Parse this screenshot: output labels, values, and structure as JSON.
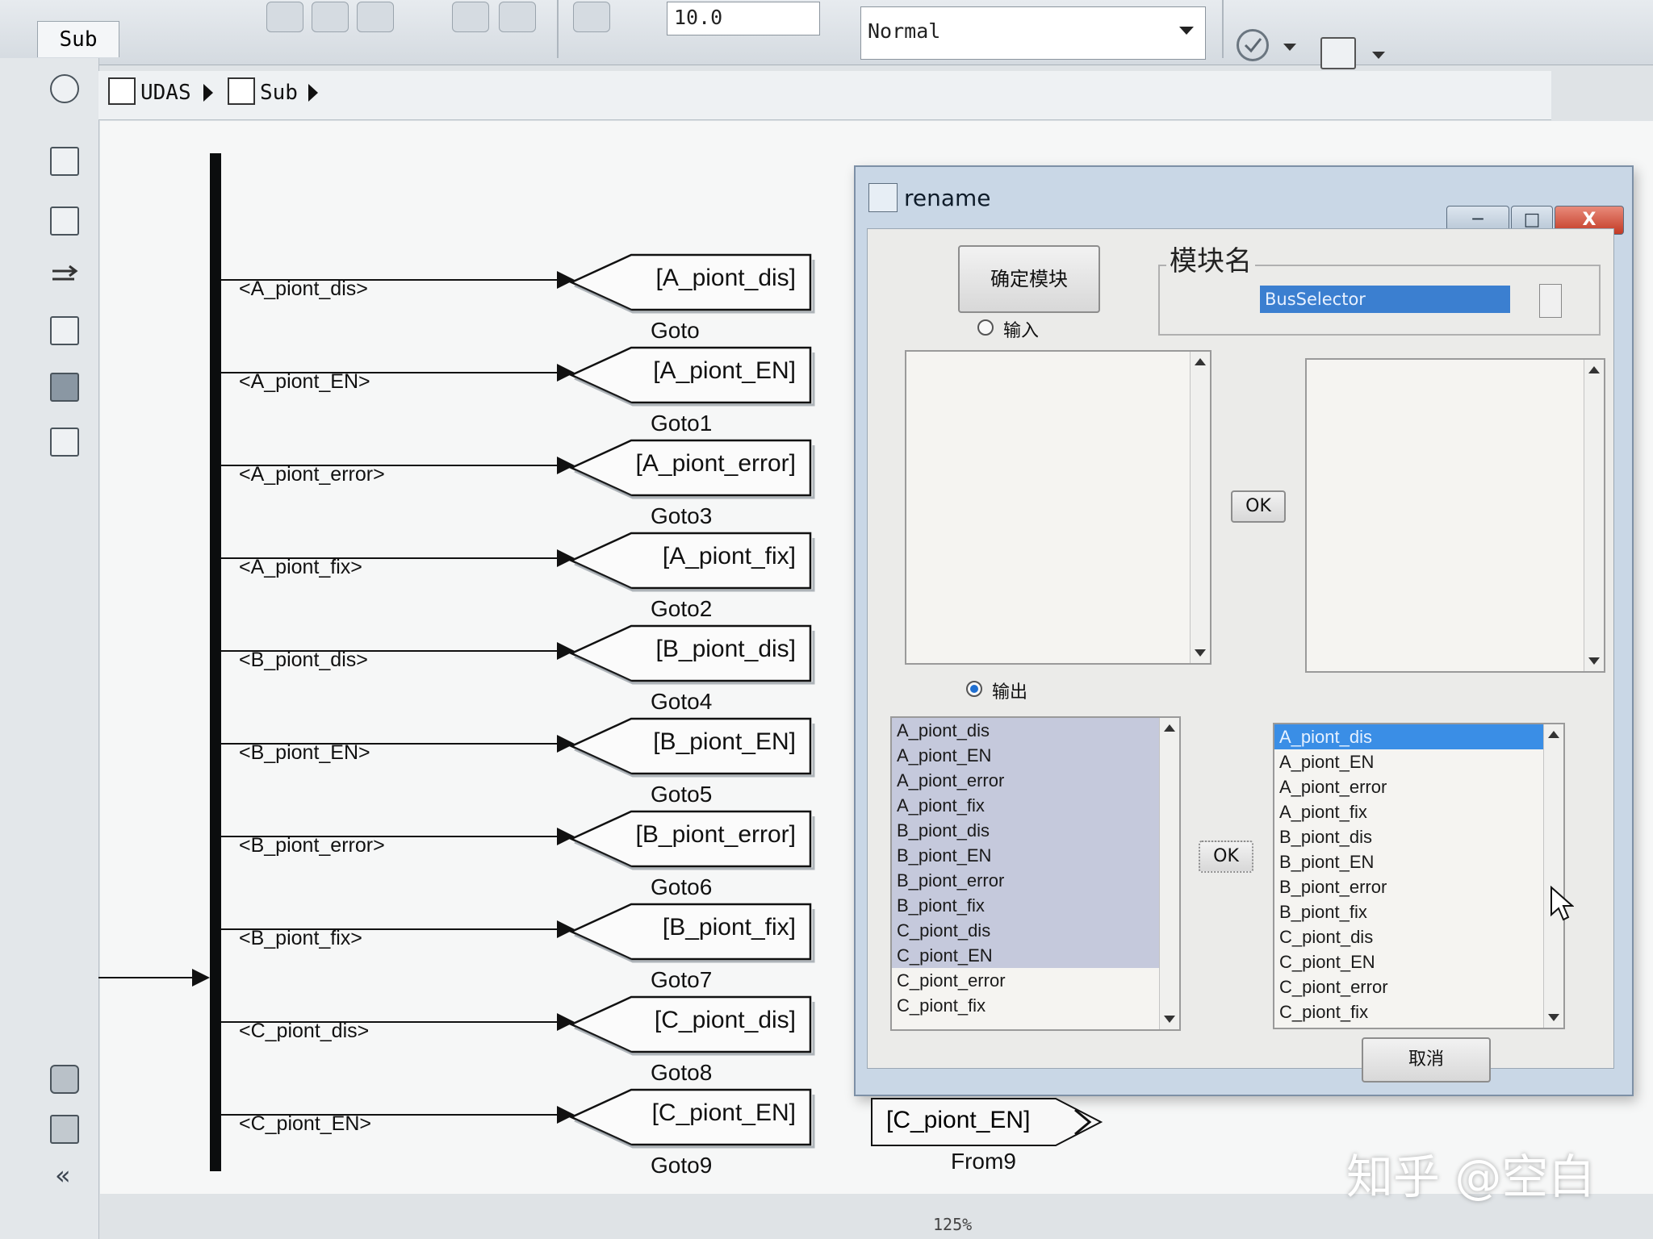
{
  "toolbar": {
    "sim_time": "10.0",
    "sim_mode": "Normal"
  },
  "tab": {
    "label": "Sub"
  },
  "breadcrumb": {
    "items": [
      "UDAS",
      "Sub"
    ]
  },
  "signals": [
    {
      "label": "<A_piont_dis>",
      "goto_tag": "[A_piont_dis]",
      "goto_name": "Goto"
    },
    {
      "label": "<A_piont_EN>",
      "goto_tag": "[A_piont_EN]",
      "goto_name": "Goto1"
    },
    {
      "label": "<A_piont_error>",
      "goto_tag": "[A_piont_error]",
      "goto_name": "Goto3"
    },
    {
      "label": "<A_piont_fix>",
      "goto_tag": "[A_piont_fix]",
      "goto_name": "Goto2"
    },
    {
      "label": "<B_piont_dis>",
      "goto_tag": "[B_piont_dis]",
      "goto_name": "Goto4"
    },
    {
      "label": "<B_piont_EN>",
      "goto_tag": "[B_piont_EN]",
      "goto_name": "Goto5"
    },
    {
      "label": "<B_piont_error>",
      "goto_tag": "[B_piont_error]",
      "goto_name": "Goto6"
    },
    {
      "label": "<B_piont_fix>",
      "goto_tag": "[B_piont_fix]",
      "goto_name": "Goto7"
    },
    {
      "label": "<C_piont_dis>",
      "goto_tag": "[C_piont_dis]",
      "goto_name": "Goto8"
    },
    {
      "label": "<C_piont_EN>",
      "goto_tag": "[C_piont_EN]",
      "goto_name": "Goto9"
    }
  ],
  "from_block": {
    "tag": "[C_piont_EN]",
    "name": "From9"
  },
  "dialog": {
    "title": "rename",
    "confirm_button": "确定模块",
    "block_name_group": "模块名",
    "block_name_value": "BusSelector",
    "input_radio": "输入",
    "output_radio": "输出",
    "ok_top": "OK",
    "ok_bottom": "OK",
    "cancel_button": "取消",
    "output_left_list": [
      "A_piont_dis",
      "A_piont_EN",
      "A_piont_error",
      "A_piont_fix",
      "B_piont_dis",
      "B_piont_EN",
      "B_piont_error",
      "B_piont_fix",
      "C_piont_dis",
      "C_piont_EN",
      "C_piont_error",
      "C_piont_fix"
    ],
    "output_right_list": [
      "A_piont_dis",
      "A_piont_EN",
      "A_piont_error",
      "A_piont_fix",
      "B_piont_dis",
      "B_piont_EN",
      "B_piont_error",
      "B_piont_fix",
      "C_piont_dis",
      "C_piont_EN",
      "C_piont_error",
      "C_piont_fix"
    ],
    "left_selected_count": 10,
    "right_highlighted_index": 0
  },
  "status": {
    "zoom": "125%"
  },
  "watermark": "知乎 @空白"
}
